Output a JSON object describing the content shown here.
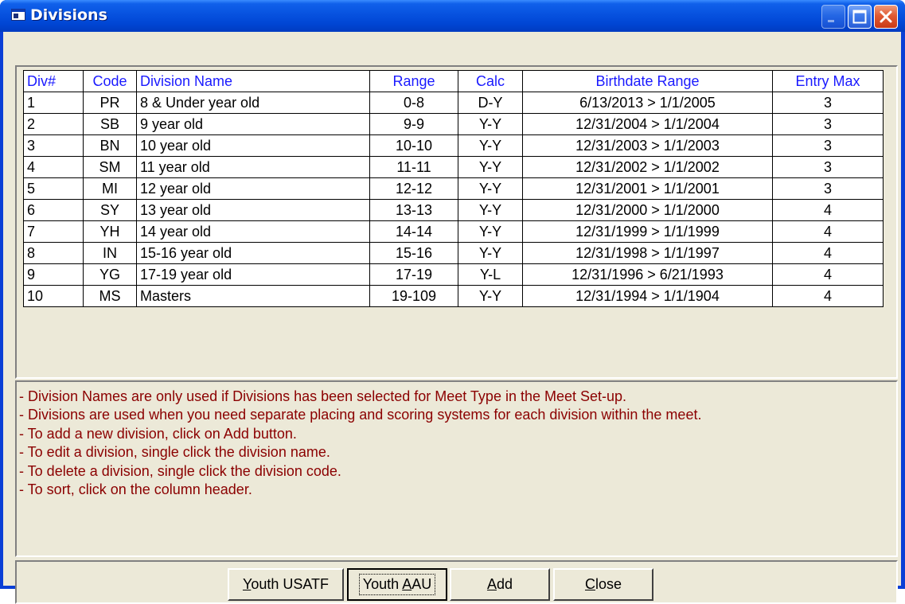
{
  "window": {
    "title": "Divisions"
  },
  "grid": {
    "headers": [
      "Div#",
      "Code",
      "Division Name",
      "Range",
      "Calc",
      "Birthdate Range",
      "Entry Max"
    ],
    "rows": [
      [
        "1",
        "PR",
        "8 & Under year old",
        "0-8",
        "D-Y",
        "6/13/2013 > 1/1/2005",
        "3"
      ],
      [
        "2",
        "SB",
        "9 year old",
        "9-9",
        "Y-Y",
        "12/31/2004 > 1/1/2004",
        "3"
      ],
      [
        "3",
        "BN",
        "10 year old",
        "10-10",
        "Y-Y",
        "12/31/2003 > 1/1/2003",
        "3"
      ],
      [
        "4",
        "SM",
        "11 year old",
        "11-11",
        "Y-Y",
        "12/31/2002 > 1/1/2002",
        "3"
      ],
      [
        "5",
        "MI",
        "12 year old",
        "12-12",
        "Y-Y",
        "12/31/2001 > 1/1/2001",
        "3"
      ],
      [
        "6",
        "SY",
        "13 year old",
        "13-13",
        "Y-Y",
        "12/31/2000 > 1/1/2000",
        "4"
      ],
      [
        "7",
        "YH",
        "14 year old",
        "14-14",
        "Y-Y",
        "12/31/1999 > 1/1/1999",
        "4"
      ],
      [
        "8",
        "IN",
        "15-16 year old",
        "15-16",
        "Y-Y",
        "12/31/1998 > 1/1/1997",
        "4"
      ],
      [
        "9",
        "YG",
        "17-19 year old",
        "17-19",
        "Y-L",
        "12/31/1996 > 6/21/1993",
        "4"
      ],
      [
        "10",
        "MS",
        "Masters",
        "19-109",
        "Y-Y",
        "12/31/1994 > 1/1/1904",
        "4"
      ]
    ]
  },
  "notes": [
    "- Division Names are only used if Divisions has been selected for Meet Type in the Meet Set-up.",
    "- Divisions are used when you need separate placing and scoring systems for each division within the meet.",
    "- To add a new division, click on Add button.",
    "- To edit a division, single click the division name.",
    "- To delete a division, single click the division code.",
    "- To sort, click on the column header."
  ],
  "buttons": {
    "youth_usatf": {
      "mnemonic": "Y",
      "rest": "outh USATF"
    },
    "youth_aau": {
      "before": "Youth ",
      "mnemonic": "A",
      "rest": "AU"
    },
    "add": {
      "mnemonic": "A",
      "rest": "dd"
    },
    "close": {
      "mnemonic": "C",
      "rest": "lose"
    }
  },
  "colors": {
    "header_text": "#1a1aff",
    "note_text": "#8b0000",
    "face": "#ece9d8",
    "titlebar": "#0752df"
  },
  "icons": {
    "app": "window-app-icon",
    "minimize": "minimize-icon",
    "maximize": "maximize-icon",
    "close": "close-icon"
  }
}
